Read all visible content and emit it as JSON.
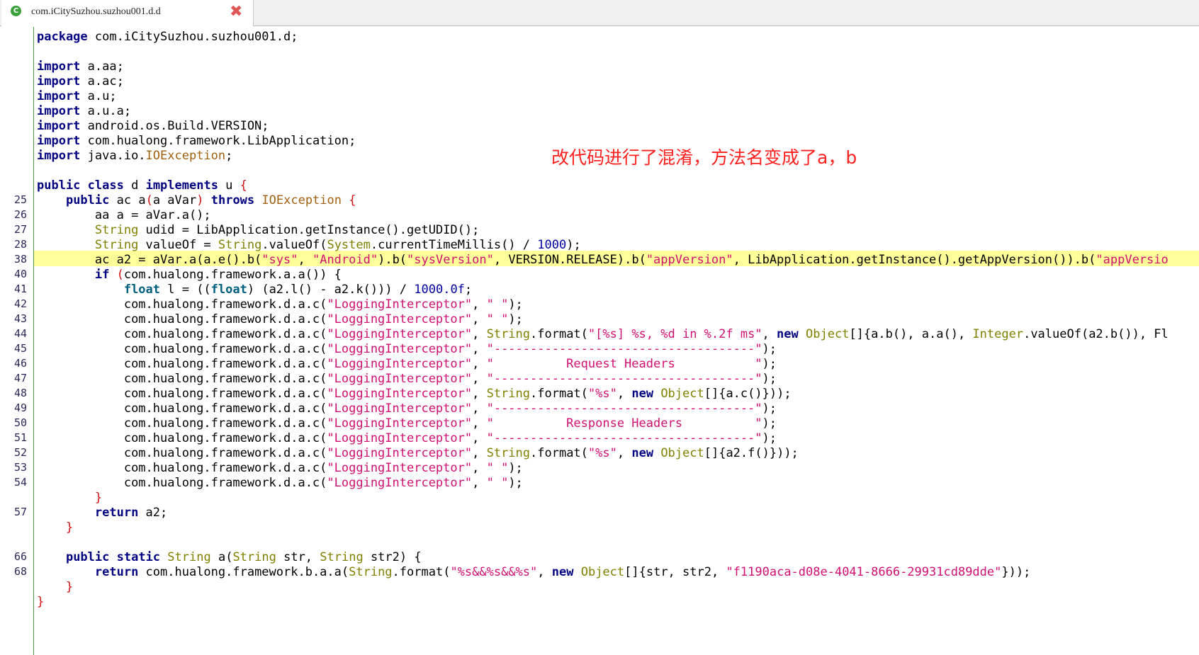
{
  "tab": {
    "icon": "class-file-icon",
    "title": "com.iCitySuzhou.suzhou001.d.d",
    "close_label": "✖"
  },
  "annotation": "改代码进行了混淆，方法名变成了a，b",
  "line_numbers": [
    "25",
    "26",
    "27",
    "28",
    "38",
    "40",
    "41",
    "42",
    "43",
    "44",
    "45",
    "46",
    "47",
    "48",
    "49",
    "50",
    "51",
    "52",
    "53",
    "54",
    "57",
    "66",
    "68"
  ],
  "code": {
    "package_kw": "package",
    "package_name": " com.iCitySuzhou.suzhou001.d;",
    "import_kw": "import",
    "imports": [
      " a.aa;",
      " a.ac;",
      " a.u;",
      " a.u.a;",
      " android.os.Build.VERSION;",
      " com.hualong.framework.LibApplication;",
      " java.io."
    ],
    "ioexception": "IOException",
    "class_public": "public",
    "class_kw": "class",
    "class_name": " d ",
    "implements_kw": "implements",
    "class_iface": " u ",
    "lbrace": "{",
    "rbrace": "}",
    "m1_ret": " ac a",
    "m1_param": "a aVar",
    "throws_kw": "throws",
    "l26": "aa a = aVar.a();",
    "string_t": "String",
    "l27_rest": " udid = LibApplication.getInstance().getUDID();",
    "l28_mid": " valueOf = ",
    "l28_call": ".valueOf(",
    "system_t": "System",
    "l28_call2": ".currentTimeMillis() / ",
    "l28_num": "1000",
    "l38_a": "ac a2 = aVar.a(a.e().b(",
    "l38_s1": "\"sys\"",
    "l38_s2": "\"Android\"",
    "l38_s3": "\"sysVersion\"",
    "l38_b": ", VERSION.RELEASE).b(",
    "l38_s4": "\"appVersion\"",
    "l38_c": ", LibApplication.getInstance().getAppVersion()).b(",
    "l38_s5": "\"appVersio",
    "if_kw": "if",
    "l40_rest": "com.hualong.framework.a.a()) {",
    "float_kw": "float",
    "l41_a": " l = ((",
    "l41_b": ") (a2.l() - a2.k())) / ",
    "l41_num": "1000.0f",
    "log_call": "com.hualong.framework.d.a.c(",
    "log_tag": "\"LoggingInterceptor\"",
    "log_blank": "\" \"",
    "l44_fmt": "\"[%s] %s, %d in %.2f ms\"",
    "new_kw": "new",
    "object_t": "Object",
    "l44_args": "[]{a.b(), a.a(), ",
    "integer_t": "Integer",
    "l44_tail": ".valueOf(a2.b()), Fl",
    "dash_str": "\"------------------------------------\"",
    "req_str": "\"          Request Headers           \"",
    "resp_str": "\"          Response Headers          \"",
    "fmt_s": "\"%s\"",
    "l48_args": "[]{a.c()}));",
    "l52_args": "[]{a2.f()}));",
    "return_kw": "return",
    "l57_rest": " a2;",
    "static_kw": "static",
    "m2_name": " a(",
    "m2_params": " str, ",
    "m2_params2": " str2) {",
    "l68_a": " com.hualong.framework.b.a.a(",
    "l68_fmt": "\"%s&&%s&&%s\"",
    "l68_args": "[]{str, str2, ",
    "l68_key": "\"f1190aca-d08e-4041-8666-29931cd89dde\"",
    "l68_end": "}));"
  }
}
